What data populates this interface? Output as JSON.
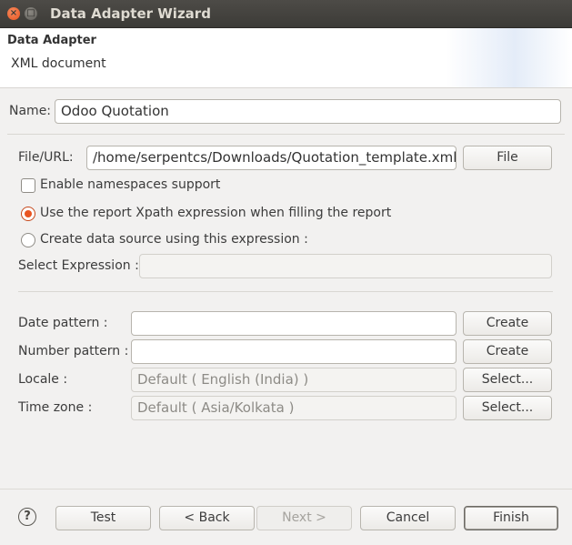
{
  "window": {
    "title": "Data Adapter Wizard",
    "close_glyph": "×",
    "max_glyph": "□"
  },
  "header": {
    "title": "Data Adapter",
    "subtitle": "XML document"
  },
  "name": {
    "label": "Name:",
    "value": "Odoo Quotation"
  },
  "file": {
    "label": "File/URL:",
    "value": "/home/serpentcs/Downloads/Quotation_template.xml",
    "button": "File"
  },
  "options": {
    "namespaces_label": "Enable namespaces support",
    "namespaces_checked": false,
    "use_report_xpath_label": "Use the report Xpath expression when filling the report",
    "create_ds_label": "Create data source using this expression :",
    "selected": "use_report_xpath"
  },
  "select_expression": {
    "label": "Select Expression :",
    "value": ""
  },
  "date_pattern": {
    "label": "Date pattern :",
    "value": "",
    "button": "Create"
  },
  "number_pattern": {
    "label": "Number pattern :",
    "value": "",
    "button": "Create"
  },
  "locale": {
    "label": "Locale :",
    "value": "Default ( English (India) )",
    "button": "Select..."
  },
  "time_zone": {
    "label": "Time zone :",
    "value": "Default ( Asia/Kolkata )",
    "button": "Select..."
  },
  "footer": {
    "help_glyph": "?",
    "test": "Test",
    "back": "< Back",
    "next": "Next >",
    "cancel": "Cancel",
    "finish": "Finish"
  },
  "colors": {
    "accent": "#e95420",
    "titlebar": "#3c3b37"
  }
}
